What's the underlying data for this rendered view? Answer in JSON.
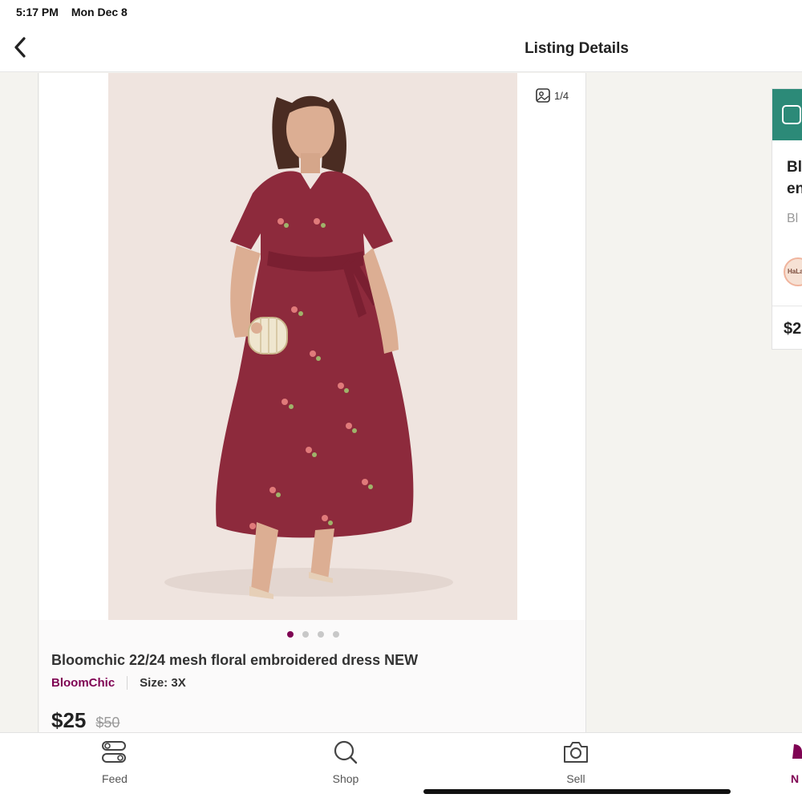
{
  "status_bar": {
    "time": "5:17 PM",
    "date": "Mon Dec 8"
  },
  "nav": {
    "title": "Listing Details",
    "back_icon": "chevron-left-icon"
  },
  "listing": {
    "photo_counter": "1/4",
    "photo_count": 4,
    "active_photo_index": 0,
    "title": "Bloomchic 22/24 mesh floral embroidered dress NEW",
    "brand": "BloomChic",
    "size": "Size: 3X",
    "price": "$25",
    "original_price": "$50",
    "colors": {
      "brand_accent": "#7f0353",
      "dress": "#8d2a3c",
      "photo_bg": "#efe4df"
    }
  },
  "side_card": {
    "title": "Bl\nen",
    "brand": "Bl",
    "avatar_text": "HaLa",
    "price": "$2",
    "header_color": "#2c8a78"
  },
  "tab_bar": {
    "items": [
      {
        "label": "Feed",
        "icon": "feed-icon"
      },
      {
        "label": "Shop",
        "icon": "search-icon"
      },
      {
        "label": "Sell",
        "icon": "camera-icon"
      },
      {
        "label": "N",
        "icon": "bell-icon",
        "active": true
      }
    ]
  }
}
